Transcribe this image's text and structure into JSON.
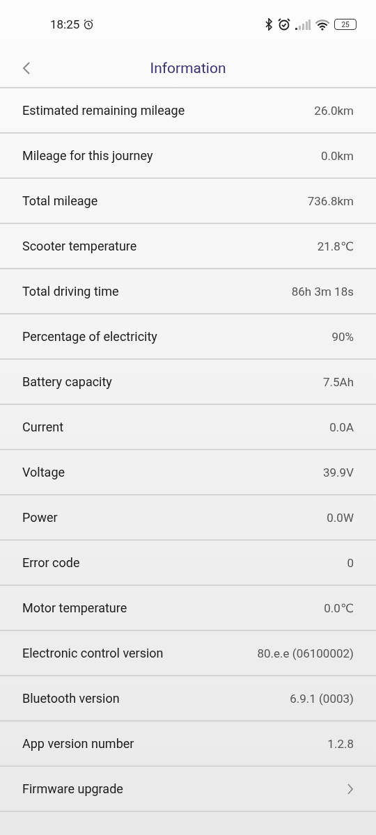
{
  "status_bar": {
    "time": "18:25",
    "battery": "25"
  },
  "header": {
    "title": "Information"
  },
  "rows": [
    {
      "kind": "value",
      "label": "Estimated remaining mileage",
      "value": "26.0km"
    },
    {
      "kind": "value",
      "label": "Mileage for this journey",
      "value": "0.0km"
    },
    {
      "kind": "value",
      "label": "Total mileage",
      "value": "736.8km"
    },
    {
      "kind": "value",
      "label": "Scooter temperature",
      "value": "21.8℃"
    },
    {
      "kind": "value",
      "label": "Total driving time",
      "value": "86h 3m 18s"
    },
    {
      "kind": "value",
      "label": "Percentage of electricity",
      "value": "90%"
    },
    {
      "kind": "value",
      "label": "Battery capacity",
      "value": "7.5Ah"
    },
    {
      "kind": "value",
      "label": "Current",
      "value": "0.0A"
    },
    {
      "kind": "value",
      "label": "Voltage",
      "value": "39.9V"
    },
    {
      "kind": "value",
      "label": "Power",
      "value": "0.0W"
    },
    {
      "kind": "value",
      "label": "Error code",
      "value": "0"
    },
    {
      "kind": "value",
      "label": "Motor temperature",
      "value": "0.0℃"
    },
    {
      "kind": "value",
      "label": "Electronic control version",
      "value": "80.e.e (06100002)"
    },
    {
      "kind": "value",
      "label": "Bluetooth version",
      "value": "6.9.1 (0003)"
    },
    {
      "kind": "value",
      "label": "App version number",
      "value": "1.2.8"
    },
    {
      "kind": "link",
      "label": "Firmware upgrade"
    }
  ]
}
